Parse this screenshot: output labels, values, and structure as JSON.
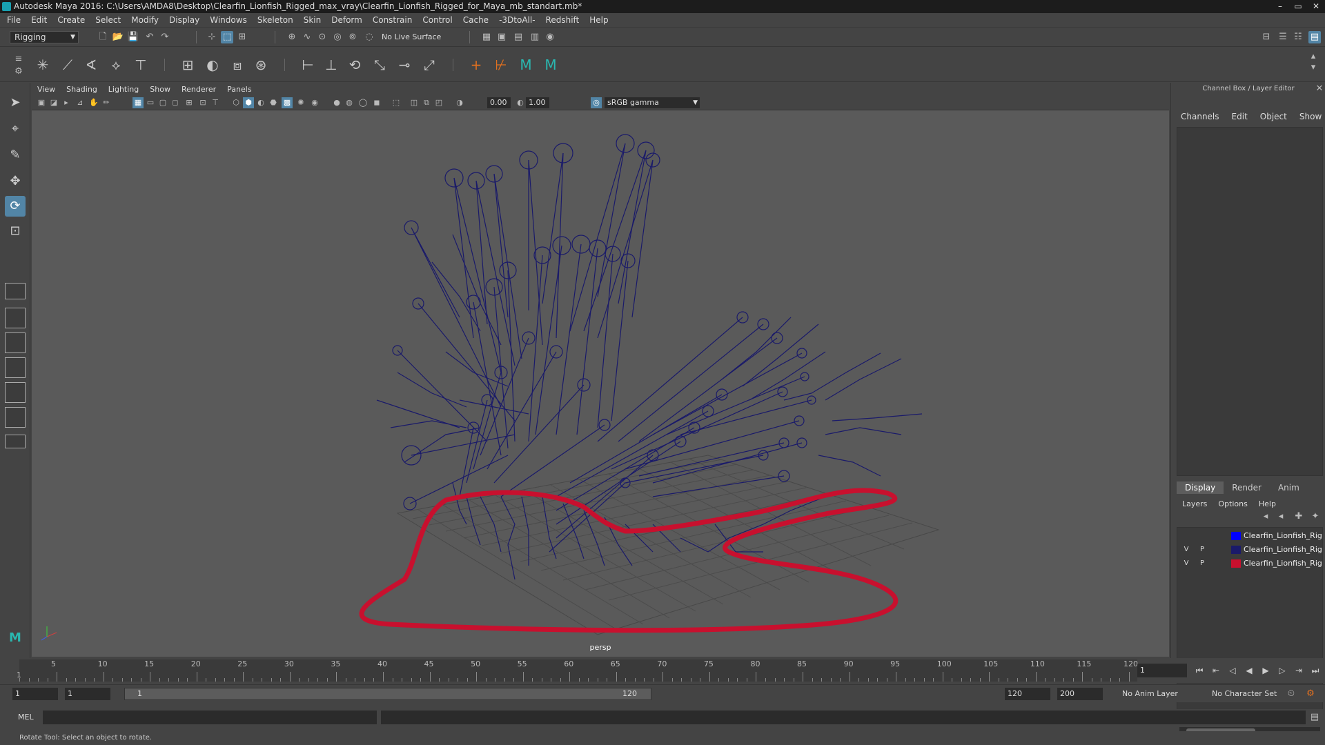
{
  "window": {
    "title": "Autodesk Maya 2016: C:\\Users\\AMDA8\\Desktop\\Clearfin_Lionfish_Rigged_max_vray\\Clearfin_Lionfish_Rigged_for_Maya_mb_standart.mb*",
    "minimize": "–",
    "maximize": "▭",
    "close": "✕"
  },
  "menubar": [
    "File",
    "Edit",
    "Create",
    "Select",
    "Modify",
    "Display",
    "Windows",
    "Skeleton",
    "Skin",
    "Deform",
    "Constrain",
    "Control",
    "Cache",
    "-3DtoAll-",
    "Redshift",
    "Help"
  ],
  "statusline": {
    "mode": "Rigging",
    "live_surface": "No Live Surface"
  },
  "panel": {
    "menu": [
      "View",
      "Shading",
      "Lighting",
      "Show",
      "Renderer",
      "Panels"
    ],
    "exposure": "0.00",
    "gamma": "1.00",
    "color_space": "sRGB gamma",
    "camera": "persp"
  },
  "channelbox": {
    "title": "Channel Box / Layer Editor",
    "menu": [
      "Channels",
      "Edit",
      "Object",
      "Show"
    ],
    "tabs": [
      "Display",
      "Render",
      "Anim"
    ],
    "layer_menu": [
      "Layers",
      "Options",
      "Help"
    ],
    "layers": [
      {
        "visible": "",
        "playback": "",
        "color": "#0000ff",
        "name": "Clearfin_Lionfish_Rigg"
      },
      {
        "visible": "V",
        "playback": "P",
        "color": "#1a1a6a",
        "name": "Clearfin_Lionfish_Rigg"
      },
      {
        "visible": "V",
        "playback": "P",
        "color": "#c8102e",
        "name": "Clearfin_Lionfish_Rigg"
      }
    ]
  },
  "timeslider": {
    "ticks": [
      "5",
      "10",
      "15",
      "20",
      "25",
      "30",
      "35",
      "40",
      "45",
      "50",
      "55",
      "60",
      "65",
      "70",
      "75",
      "80",
      "85",
      "90",
      "95",
      "100",
      "105",
      "110",
      "115",
      "120"
    ],
    "start_label": "1",
    "current_frame": "1"
  },
  "range": {
    "start": "1",
    "playback_start": "1",
    "range_start_label": "1",
    "range_end_label": "120",
    "playback_end": "120",
    "end": "200",
    "anim_layer": "No Anim Layer",
    "character_set": "No Character Set"
  },
  "cmdline": {
    "label": "MEL"
  },
  "helpline": "Rotate Tool: Select an object to rotate.",
  "colors": {
    "accent": "#5285a6",
    "skeleton": "#1a1a6a",
    "curve": "#c8102e"
  }
}
